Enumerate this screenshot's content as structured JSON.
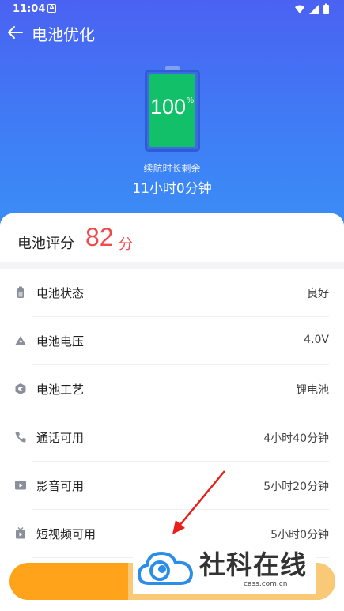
{
  "status_bar": {
    "time": "11:04",
    "notif_letter": "A"
  },
  "app_bar": {
    "title": "电池优化"
  },
  "battery": {
    "level_percent": 100,
    "level_text": "100",
    "percent_sign": "%",
    "remaining_label": "续航时长剩余",
    "remaining_value": "11小时0分钟"
  },
  "score": {
    "label": "电池评分",
    "value": "82",
    "unit": "分"
  },
  "rows": [
    {
      "icon": "battery-icon",
      "label": "电池状态",
      "value": "良好"
    },
    {
      "icon": "voltage-icon",
      "label": "电池电压",
      "value": "4.0V"
    },
    {
      "icon": "tech-icon",
      "label": "电池工艺",
      "value": "锂电池"
    },
    {
      "icon": "phone-icon",
      "label": "通话可用",
      "value": "4小时40分钟"
    },
    {
      "icon": "video-icon",
      "label": "影音可用",
      "value": "5小时20分钟"
    },
    {
      "icon": "short-video-icon",
      "label": "短视频可用",
      "value": "5小时0分钟"
    }
  ],
  "watermark": {
    "brand": "社科在线",
    "domain": "cass.com.cn"
  },
  "colors": {
    "primary": "#3f7df5",
    "battery_fill": "#11c068",
    "score": "#f24a4a",
    "button": "#ffa31a"
  }
}
